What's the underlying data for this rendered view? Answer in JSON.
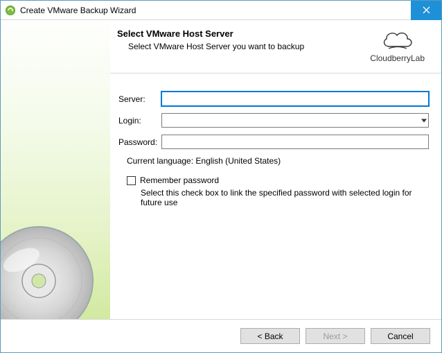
{
  "window": {
    "title": "Create VMware Backup Wizard"
  },
  "header": {
    "title": "Select VMware Host Server",
    "desc": "Select VMware Host Server you want to backup",
    "brand": "CloudberryLab"
  },
  "form": {
    "server_label": "Server:",
    "server_value": "",
    "login_label": "Login:",
    "login_value": "",
    "password_label": "Password:",
    "password_value": "",
    "language_line": "Current language: English (United States)",
    "remember_label": "Remember password",
    "remember_desc": "Select this check box to link the specified password with selected login for future use"
  },
  "footer": {
    "back": "< Back",
    "next": "Next >",
    "cancel": "Cancel"
  }
}
